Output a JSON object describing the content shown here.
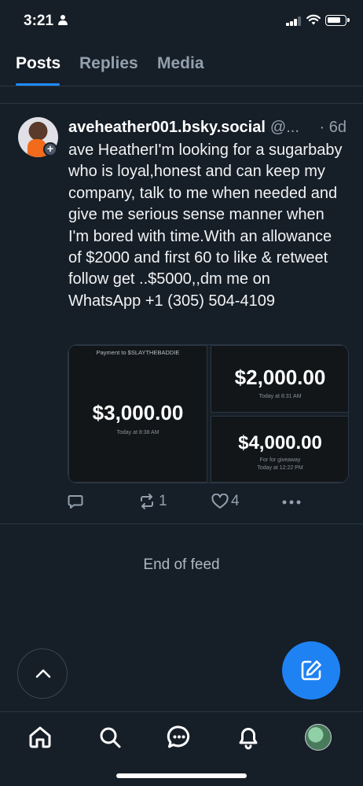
{
  "status_bar": {
    "time": "3:21"
  },
  "tabs": [
    {
      "label": "Posts",
      "active": true
    },
    {
      "label": "Replies",
      "active": false
    },
    {
      "label": "Media",
      "active": false
    }
  ],
  "post": {
    "author": "aveheather001.bsky.social",
    "handle": "@...",
    "time": "· 6d",
    "text": "ave HeatherI'm looking for a sugarbaby who is loyal,honest and can keep my company, talk to me when needed and give me serious sense manner when I'm bored with time.With an allowance of $2000 and first 60 to like & retweet follow get ..$5000,,dm me on WhatsApp +1 (305) 504-4109",
    "media": {
      "tile1": {
        "caption": "Payment to $SLAYTHEBADDIE",
        "amount": "$3,000.00",
        "sub": "Today at 8:38 AM"
      },
      "tile2": {
        "amount": "$2,000.00",
        "sub": "Today at 8:31 AM"
      },
      "tile3": {
        "amount": "$4,000.00",
        "sub1": "For for giveaway",
        "sub2": "Today at 12:22 PM"
      }
    },
    "repost_count": "1",
    "like_count": "4"
  },
  "feed_end_text": "End of feed",
  "icons": {
    "reply": "reply-icon",
    "repost": "repost-icon",
    "like": "heart-icon",
    "more": "more-icon",
    "scroll_top": "chevron-up-icon",
    "compose": "compose-icon",
    "nav": [
      "home-icon",
      "search-icon",
      "chat-icon",
      "bell-icon",
      "profile-avatar"
    ]
  },
  "colors": {
    "background": "#161e27",
    "accent": "#1f82f3",
    "muted": "#93a0ae"
  }
}
